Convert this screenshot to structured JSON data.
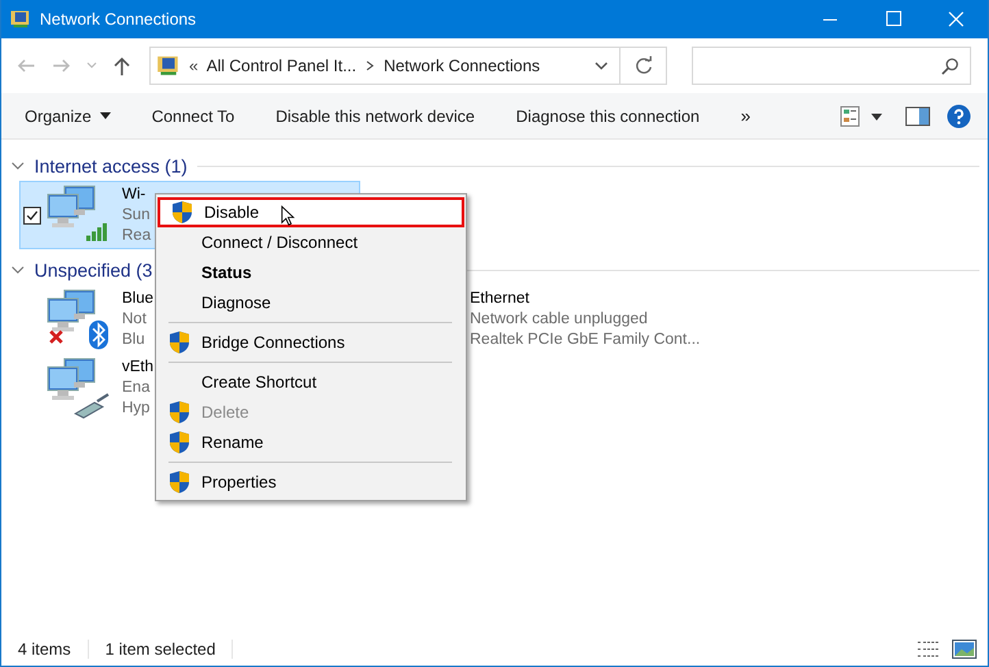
{
  "window": {
    "title": "Network Connections"
  },
  "address": {
    "prefix": "«",
    "crumbs": [
      "All Control Panel It...",
      "Network Connections"
    ]
  },
  "toolbar": {
    "items": [
      {
        "label": "Organize",
        "dropdown": true
      },
      {
        "label": "Connect To",
        "dropdown": false
      },
      {
        "label": "Disable this network device",
        "dropdown": false
      },
      {
        "label": "Diagnose this connection",
        "dropdown": false
      }
    ],
    "overflow": "»"
  },
  "groups": [
    {
      "title": "Internet access (1)",
      "items": [
        {
          "kind": "wifi",
          "name": "Wi-",
          "lines": [
            "Sun",
            "Rea"
          ],
          "selected": true
        }
      ]
    },
    {
      "title": "Unspecified (3",
      "items": [
        {
          "kind": "bluetooth",
          "name": "Blue",
          "lines": [
            "Not",
            "Blu"
          ],
          "selected": false
        },
        {
          "kind": "ethernet",
          "name": "Ethernet",
          "lines": [
            "Network cable unplugged",
            "Realtek PCIe GbE Family Cont..."
          ],
          "selected": false
        },
        {
          "kind": "cable",
          "name": "vEth",
          "lines": [
            "Ena",
            "Hyp"
          ],
          "selected": false
        }
      ]
    }
  ],
  "context_menu": {
    "items": [
      {
        "kind": "item",
        "label": "Disable",
        "shield": true,
        "bold": false,
        "disabled": false,
        "selected": true
      },
      {
        "kind": "item",
        "label": "Connect / Disconnect",
        "shield": false,
        "bold": false,
        "disabled": false,
        "selected": false
      },
      {
        "kind": "item",
        "label": "Status",
        "shield": false,
        "bold": true,
        "disabled": false,
        "selected": false
      },
      {
        "kind": "item",
        "label": "Diagnose",
        "shield": false,
        "bold": false,
        "disabled": false,
        "selected": false
      },
      {
        "kind": "separator"
      },
      {
        "kind": "item",
        "label": "Bridge Connections",
        "shield": true,
        "bold": false,
        "disabled": false,
        "selected": false
      },
      {
        "kind": "separator"
      },
      {
        "kind": "item",
        "label": "Create Shortcut",
        "shield": false,
        "bold": false,
        "disabled": false,
        "selected": false
      },
      {
        "kind": "item",
        "label": "Delete",
        "shield": true,
        "bold": false,
        "disabled": true,
        "selected": false
      },
      {
        "kind": "item",
        "label": "Rename",
        "shield": true,
        "bold": false,
        "disabled": false,
        "selected": false
      },
      {
        "kind": "separator"
      },
      {
        "kind": "item",
        "label": "Properties",
        "shield": true,
        "bold": false,
        "disabled": false,
        "selected": false
      }
    ]
  },
  "status_bar": {
    "items": [
      "4 items",
      "1 item selected"
    ]
  }
}
